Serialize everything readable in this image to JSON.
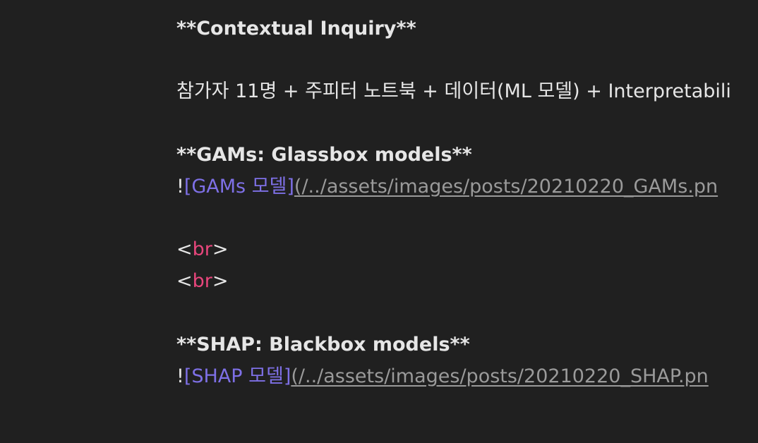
{
  "lines": {
    "contextual_heading": "**Contextual Inquiry**",
    "participants": "참가자 11명 + 주피터 노트북 + 데이터(ML 모델) + Interpretabili",
    "gams_heading": "**GAMs: Glassbox models**",
    "gams_image": {
      "bang": "!",
      "alt": "[GAMs 모델]",
      "url": "(/../assets/images/posts/20210220_GAMs.pn"
    },
    "br1": {
      "open": "<",
      "name": "br",
      "close": ">"
    },
    "br2": {
      "open": "<",
      "name": "br",
      "close": ">"
    },
    "shap_heading": "**SHAP: Blackbox models**",
    "shap_image": {
      "bang": "!",
      "alt": "[SHAP 모델]",
      "url": "(/../assets/images/posts/20210220_SHAP.pn"
    }
  },
  "colors": {
    "background": "#202020",
    "text": "#e6e6e6",
    "link_text": "#7e70e6",
    "link_url": "#9a9a9a",
    "tag_name": "#e8467c"
  }
}
